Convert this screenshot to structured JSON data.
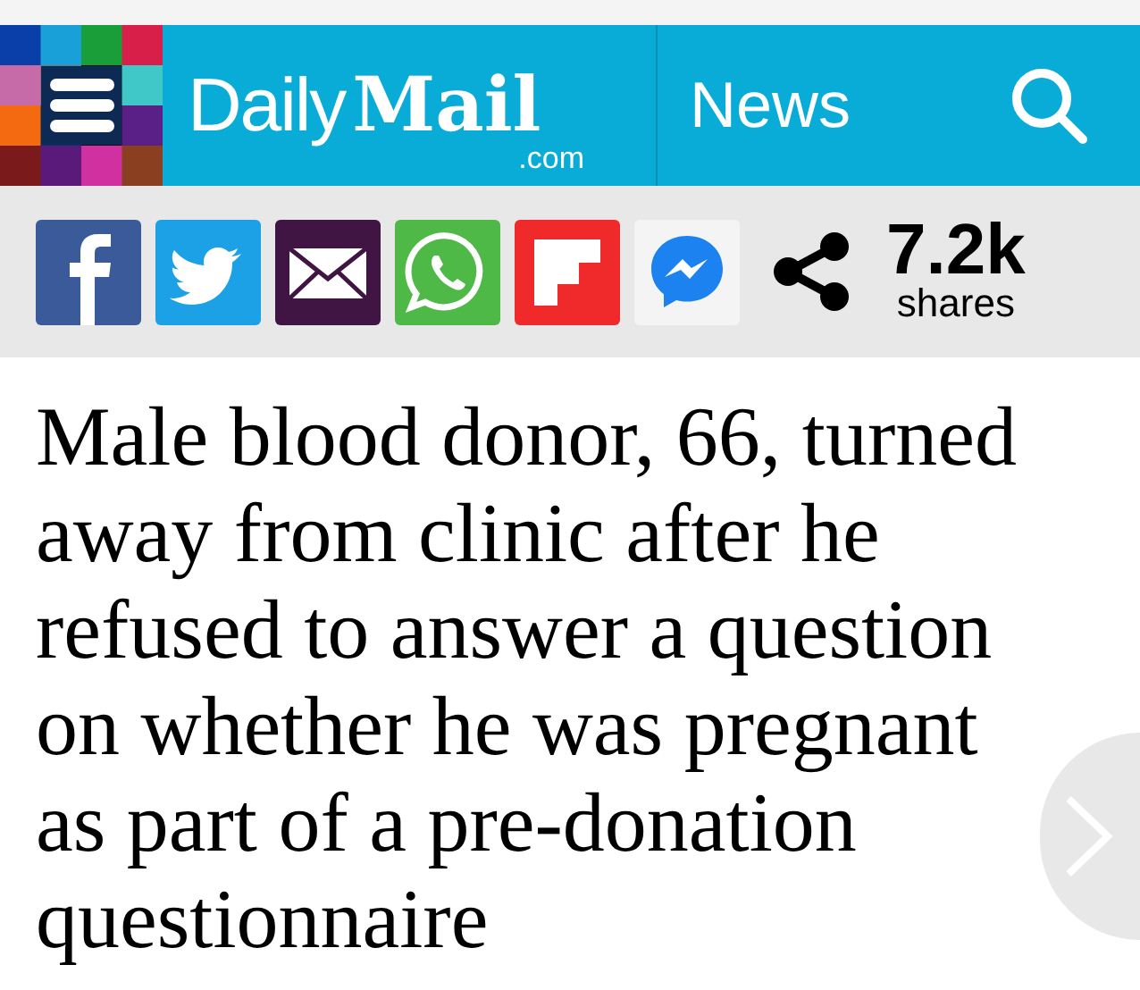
{
  "header": {
    "brand": {
      "word_1": "Daily",
      "word_2": "Mail",
      "suffix": ".com"
    },
    "section": "News"
  },
  "share_bar": {
    "buttons": [
      {
        "kind": "facebook"
      },
      {
        "kind": "twitter"
      },
      {
        "kind": "email"
      },
      {
        "kind": "whatsapp"
      },
      {
        "kind": "flipboard"
      },
      {
        "kind": "messenger"
      },
      {
        "kind": "share"
      }
    ],
    "count": "7.2k",
    "count_label": "shares"
  },
  "headline": "Male blood donor, 66, turned away from clinic after he refused to answer a question on whether he was pregnant as part of a pre-donation questionnaire"
}
